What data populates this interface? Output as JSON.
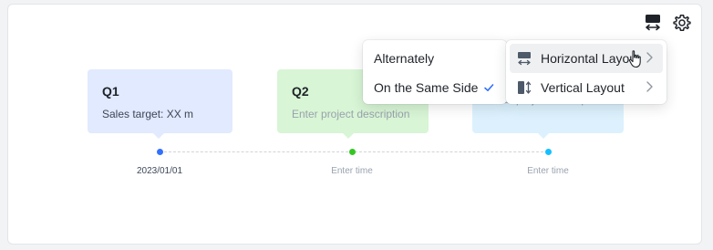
{
  "colors": {
    "blue": "#3370ff",
    "green": "#34c724",
    "cyan": "#14c0ff",
    "check": "#3370ff"
  },
  "toolbar": {
    "layout_icon": "layout-horizontal-icon",
    "settings_icon": "gear-icon"
  },
  "timeline": {
    "nodes": [
      {
        "title": "Q1",
        "description": "Sales target: XX m",
        "time": "2023/01/01"
      },
      {
        "title": "Q2",
        "description": "Enter project description",
        "time": "Enter time"
      },
      {
        "title": "",
        "description": "Enter project description",
        "time": "Enter time"
      }
    ]
  },
  "arrangement_menu": {
    "items": [
      {
        "label": "Alternately",
        "selected": false
      },
      {
        "label": "On the Same Side",
        "selected": true
      }
    ]
  },
  "layout_menu": {
    "items": [
      {
        "label": "Horizontal Layout",
        "icon": "horizontal-layout-icon"
      },
      {
        "label": "Vertical Layout",
        "icon": "vertical-layout-icon"
      }
    ]
  }
}
